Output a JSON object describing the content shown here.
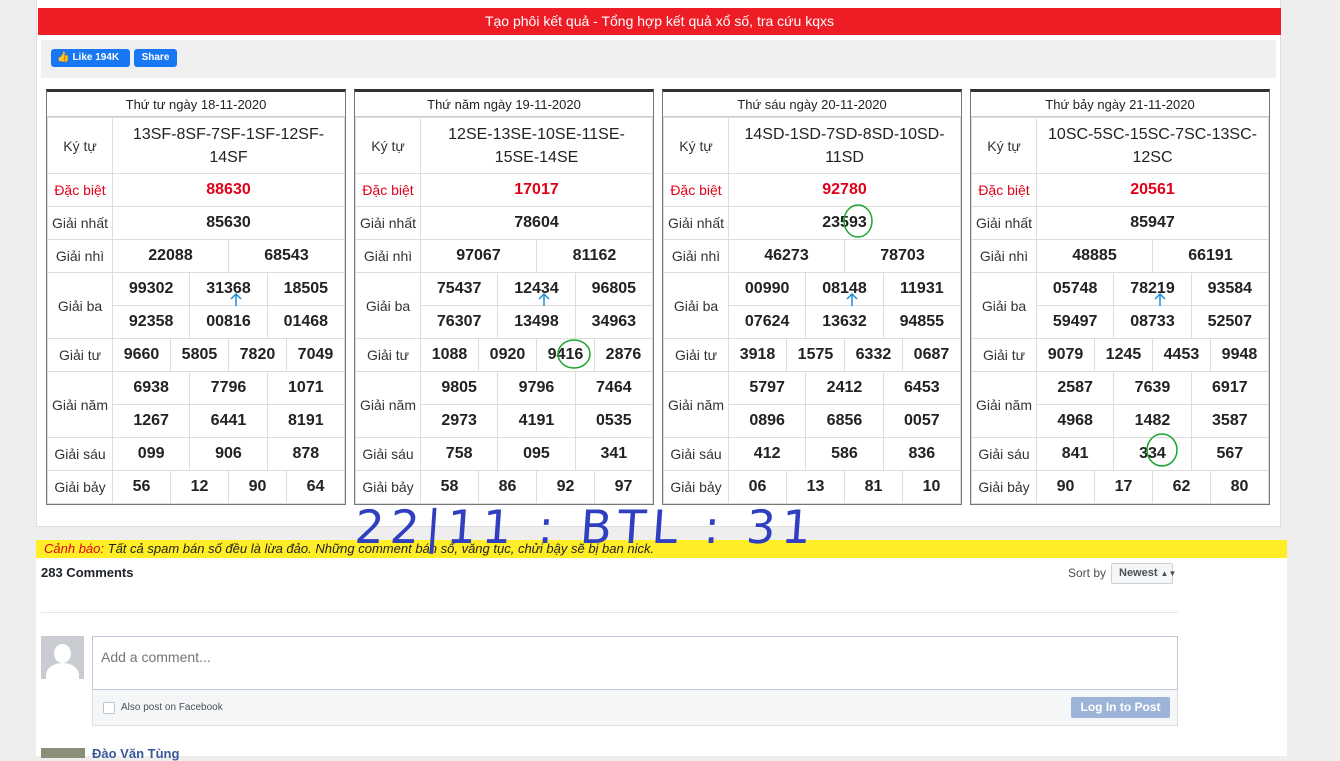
{
  "header": {
    "title": "Tạo phôi kết quả - Tổng hợp kết quả xổ số, tra cứu kqxs"
  },
  "social": {
    "like_label": "Like 194K",
    "share_label": "Share"
  },
  "labels": {
    "kytu": "Ký tự",
    "db": "Đặc biệt",
    "g1": "Giải nhất",
    "g2": "Giải nhì",
    "g3": "Giải ba",
    "g4": "Giải tư",
    "g5": "Giải năm",
    "g6": "Giải sáu",
    "g7": "Giải bảy"
  },
  "boards": [
    {
      "date": "Thứ tư ngày 18-11-2020",
      "kytu": "13SF-8SF-7SF-1SF-12SF-14SF",
      "db": "88630",
      "g1": "85630",
      "g2": [
        "22088",
        "68543"
      ],
      "g3": [
        "99302",
        "31368",
        "18505",
        "92358",
        "00816",
        "01468"
      ],
      "g4": [
        "9660",
        "5805",
        "7820",
        "7049"
      ],
      "g5": [
        "6938",
        "7796",
        "1071",
        "1267",
        "6441",
        "8191"
      ],
      "g6": [
        "099",
        "906",
        "878"
      ],
      "g7": [
        "56",
        "12",
        "90",
        "64"
      ]
    },
    {
      "date": "Thứ năm ngày 19-11-2020",
      "kytu": "12SE-13SE-10SE-11SE-15SE-14SE",
      "db": "17017",
      "g1": "78604",
      "g2": [
        "97067",
        "81162"
      ],
      "g3": [
        "75437",
        "12434",
        "96805",
        "76307",
        "13498",
        "34963"
      ],
      "g4": [
        "1088",
        "0920",
        "9416",
        "2876"
      ],
      "g5": [
        "9805",
        "9796",
        "7464",
        "2973",
        "4191",
        "0535"
      ],
      "g6": [
        "758",
        "095",
        "341"
      ],
      "g7": [
        "58",
        "86",
        "92",
        "97"
      ]
    },
    {
      "date": "Thứ sáu ngày 20-11-2020",
      "kytu": "14SD-1SD-7SD-8SD-10SD-11SD",
      "db": "92780",
      "g1": "23593",
      "g2": [
        "46273",
        "78703"
      ],
      "g3": [
        "00990",
        "08148",
        "11931",
        "07624",
        "13632",
        "94855"
      ],
      "g4": [
        "3918",
        "1575",
        "6332",
        "0687"
      ],
      "g5": [
        "5797",
        "2412",
        "6453",
        "0896",
        "6856",
        "0057"
      ],
      "g6": [
        "412",
        "586",
        "836"
      ],
      "g7": [
        "06",
        "13",
        "81",
        "10"
      ]
    },
    {
      "date": "Thứ bảy ngày 21-11-2020",
      "kytu": "10SC-5SC-15SC-7SC-13SC-12SC",
      "db": "20561",
      "g1": "85947",
      "g2": [
        "48885",
        "66191"
      ],
      "g3": [
        "05748",
        "78219",
        "93584",
        "59497",
        "08733",
        "52507"
      ],
      "g4": [
        "9079",
        "1245",
        "4453",
        "9948"
      ],
      "g5": [
        "2587",
        "7639",
        "6917",
        "4968",
        "1482",
        "3587"
      ],
      "g6": [
        "841",
        "334",
        "567"
      ],
      "g7": [
        "90",
        "17",
        "62",
        "80"
      ]
    }
  ],
  "warning": {
    "label": "Cảnh báo:",
    "text": "Tất cả spam bán số đều là lừa đảo. Những comment bán số, văng tục, chửi bậy sẽ bị ban nick."
  },
  "comments": {
    "count": "283 Comments",
    "sort_label": "Sort by",
    "sort_value": "Newest",
    "placeholder": "Add a comment...",
    "also_post": "Also post on Facebook",
    "login_button": "Log In to Post",
    "next_commenter": "Đào Văn Tùng"
  },
  "annotation": {
    "handwritten": "22|11 : BTL : 31",
    "color": "#2f3fc0"
  }
}
